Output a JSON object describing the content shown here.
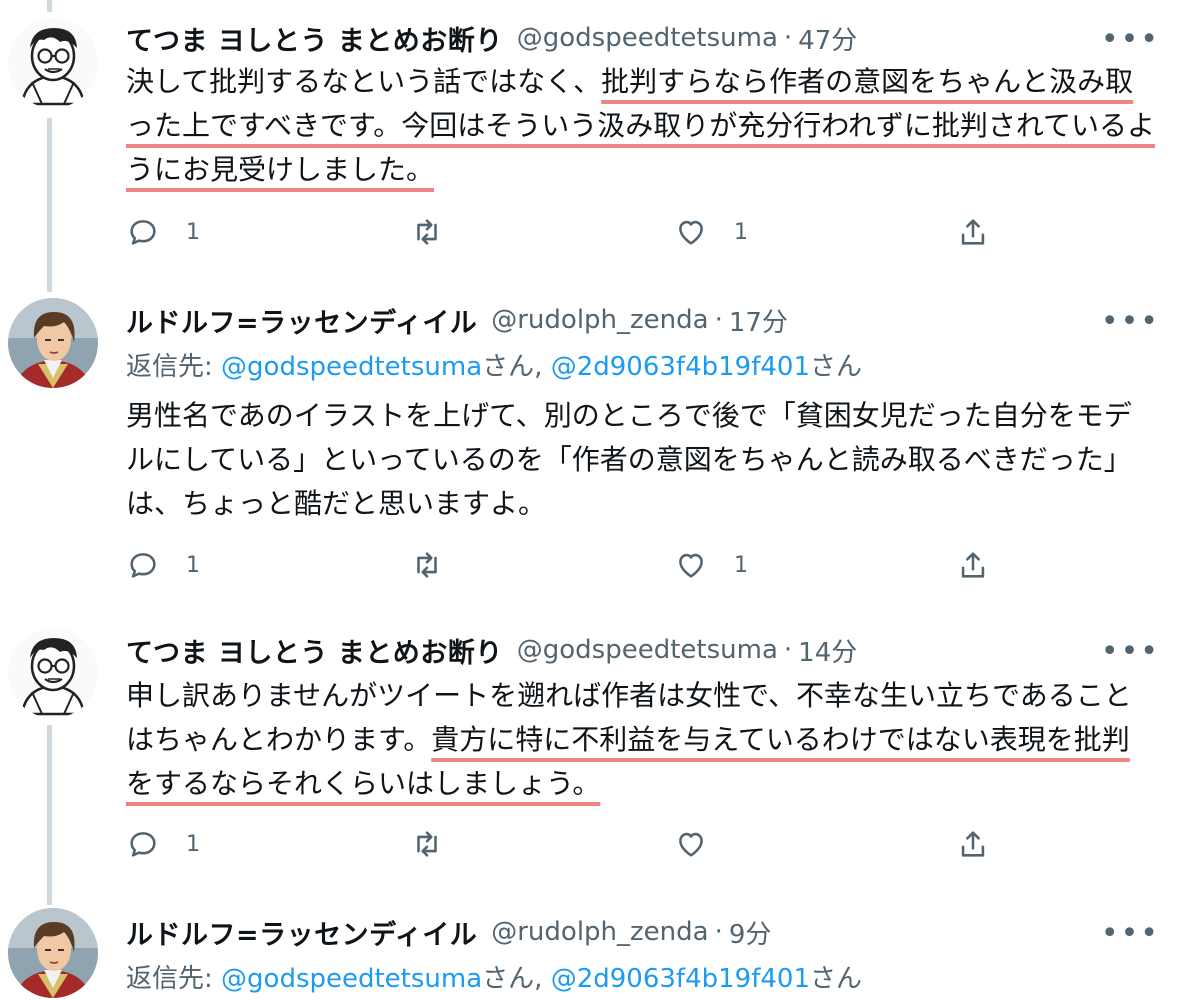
{
  "tweets": [
    {
      "name": "てつま ヨしとう まとめお断り",
      "handle": "@godspeedtetsuma",
      "sep": "·",
      "time": "47分",
      "text": {
        "p1": "決して批判するなという話ではなく、",
        "p2": "批判すらなら作者の意図をちゃんと汲み取った上ですべきです。今回はそういう汲み取りが充分行われずに批判されているようにお見受けしました。"
      },
      "reply_count": "1",
      "like_count": "1"
    },
    {
      "name": "ルドルフ=ラッセンディイル",
      "handle": "@rudolph_zenda",
      "sep": "·",
      "time": "17分",
      "reply_to": {
        "label": "返信先: ",
        "mention1": "@godspeedtetsuma",
        "san1": "さん, ",
        "mention2": "@2d9063f4b19f401",
        "san2": "さん"
      },
      "text": "男性名であのイラストを上げて、別のところで後で「貧困女児だった自分をモデルにしている」といっているのを「作者の意図をちゃんと読み取るべきだった」は、ちょっと酷だと思いますよ。",
      "reply_count": "1",
      "like_count": "1"
    },
    {
      "name": "てつま ヨしとう まとめお断り",
      "handle": "@godspeedtetsuma",
      "sep": "·",
      "time": "14分",
      "text": {
        "p1": "申し訳ありませんがツイートを遡れば作者は女性で、不幸な生い立ちであることはちゃんとわかります。",
        "p2": "貴方に特に不利益を与えているわけではない表現を批判をするならそれくらいはしましょう。"
      },
      "reply_count": "1",
      "like_count": ""
    },
    {
      "name": "ルドルフ=ラッセンディイル",
      "handle": "@rudolph_zenda",
      "sep": "·",
      "time": "9分",
      "reply_to": {
        "label": "返信先: ",
        "mention1": "@godspeedtetsuma",
        "san1": "さん, ",
        "mention2": "@2d9063f4b19f401",
        "san2": "さん"
      }
    }
  ],
  "icons": {
    "more": "more-dots-icon",
    "reply": "reply-bubble-icon",
    "retweet": "retweet-icon",
    "like": "heart-icon",
    "share": "share-icon"
  },
  "colors": {
    "text": "#0f1419",
    "muted": "#536471",
    "link": "#1d9bf0",
    "highlight_underline": "#ee8585",
    "thread_line": "#cfd9de"
  },
  "more_glyph": "•••"
}
